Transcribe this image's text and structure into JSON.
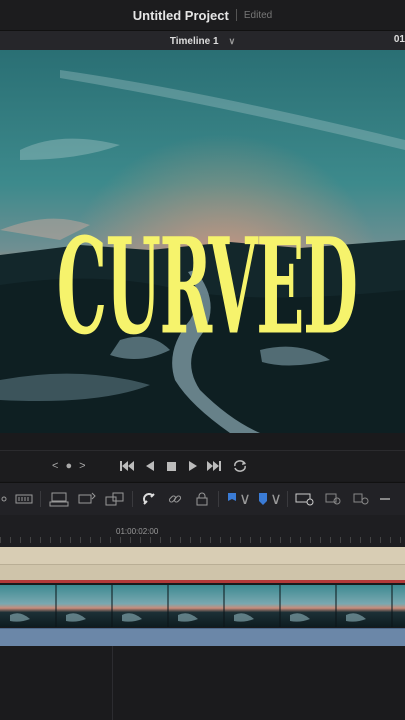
{
  "header": {
    "project_title": "Untitled Project",
    "status": "Edited"
  },
  "timeline_bar": {
    "timeline_name": "Timeline 1",
    "timecode_partial": "01"
  },
  "viewer": {
    "overlay_title": "CURVED",
    "overlay_color": "#f6f36c"
  },
  "transport": {
    "jog_label": "< ● >",
    "controls": [
      "skip-back-icon",
      "play-reverse-icon",
      "stop-icon",
      "play-icon",
      "skip-forward-icon",
      "loop-icon"
    ]
  },
  "toolbar": {
    "tools": [
      "trim-icon",
      "insert-icon",
      "overwrite-icon",
      "replace-icon",
      "place-on-top-icon",
      "snapping-icon",
      "link-icon",
      "lock-icon",
      "flag-icon",
      "marker-icon",
      "zoom-fit-icon",
      "zoom-detail-icon",
      "zoom-custom-icon",
      "zoom-out-icon"
    ],
    "accent_color": "#3a7bd5"
  },
  "ruler": {
    "timecode_label": "01:00:02:00"
  },
  "tracks": {
    "video_clip_color": "#2e4a5a",
    "audio_clip_color": "#6b87a8",
    "title_clip_color": "#d8cdb4"
  }
}
